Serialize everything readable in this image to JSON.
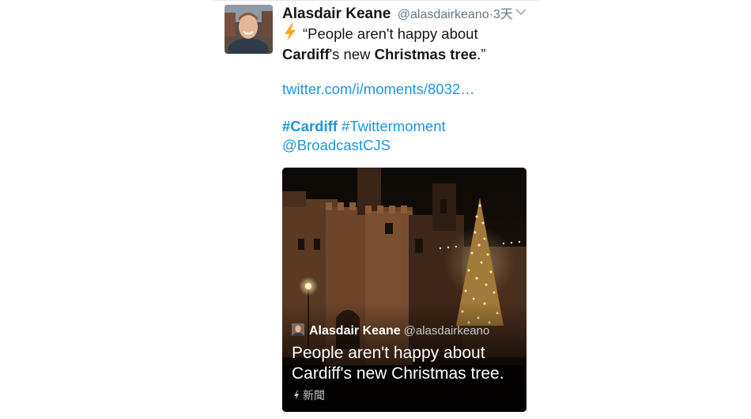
{
  "tweet": {
    "author_name": "Alasdair Keane",
    "author_handle": "@alasdairkeano",
    "separator": "·",
    "time": "3天",
    "text_open": "“People aren't happy about",
    "text_bold1": "Cardiff",
    "text_mid": "'s new ",
    "text_bold2": "Christmas tree",
    "text_close": ".”",
    "link": "twitter.com/i/moments/8032…",
    "hashtag1": "#Cardiff",
    "hashtag2": "#Twittermoment",
    "mention": "@BroadcastCJS",
    "icons": {
      "menu": "chevron-down-icon",
      "lead": "lightning-icon"
    }
  },
  "card": {
    "author_name": "Alasdair Keane",
    "author_handle": "@alasdairkeano",
    "title": "People aren't happy about Cardiff's new Christmas tree.",
    "category": "新聞",
    "icons": {
      "category": "lightning-icon"
    }
  },
  "colors": {
    "link": "#1b95e0",
    "muted": "#657786",
    "text": "#14171a",
    "bolt": "#f5a623"
  }
}
